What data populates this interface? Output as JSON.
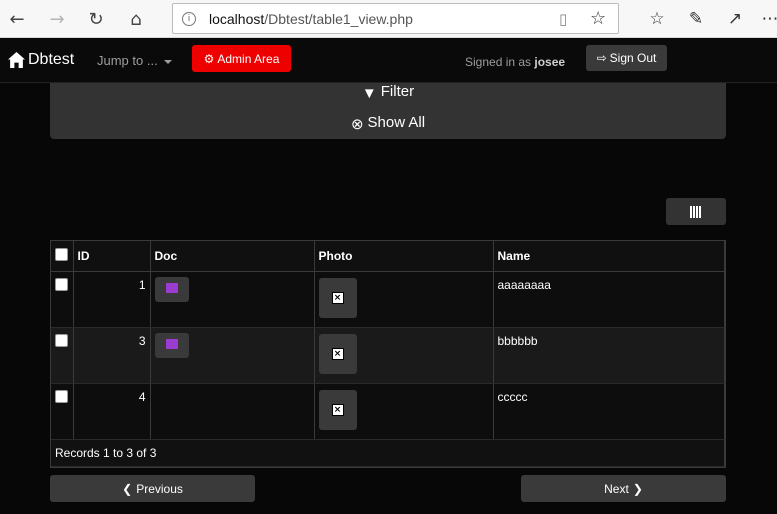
{
  "browser": {
    "url_host": "localhost",
    "url_path": "/Dbtest/table1_view.php"
  },
  "navbar": {
    "brand": "Dbtest",
    "jump_to": "Jump to ...",
    "admin_area": "Admin Area",
    "signed_in_prefix": "Signed in as",
    "username": "josee",
    "sign_out": "Sign Out"
  },
  "filter_panel": {
    "filter_label": "Filter",
    "show_all_label": "Show All"
  },
  "table": {
    "columns": [
      "ID",
      "Doc",
      "Photo",
      "Name"
    ],
    "rows": [
      {
        "id": "1",
        "has_doc": true,
        "name": "aaaaaaaa"
      },
      {
        "id": "3",
        "has_doc": true,
        "name": "bbbbbb"
      },
      {
        "id": "4",
        "has_doc": false,
        "name": "ccccc"
      }
    ],
    "records_text": "Records 1 to 3 of 3"
  },
  "pager": {
    "previous": "Previous",
    "next": "Next"
  },
  "colors": {
    "admin_red": "#ee0000",
    "doc_icon_purple": "#9a3bd1"
  }
}
